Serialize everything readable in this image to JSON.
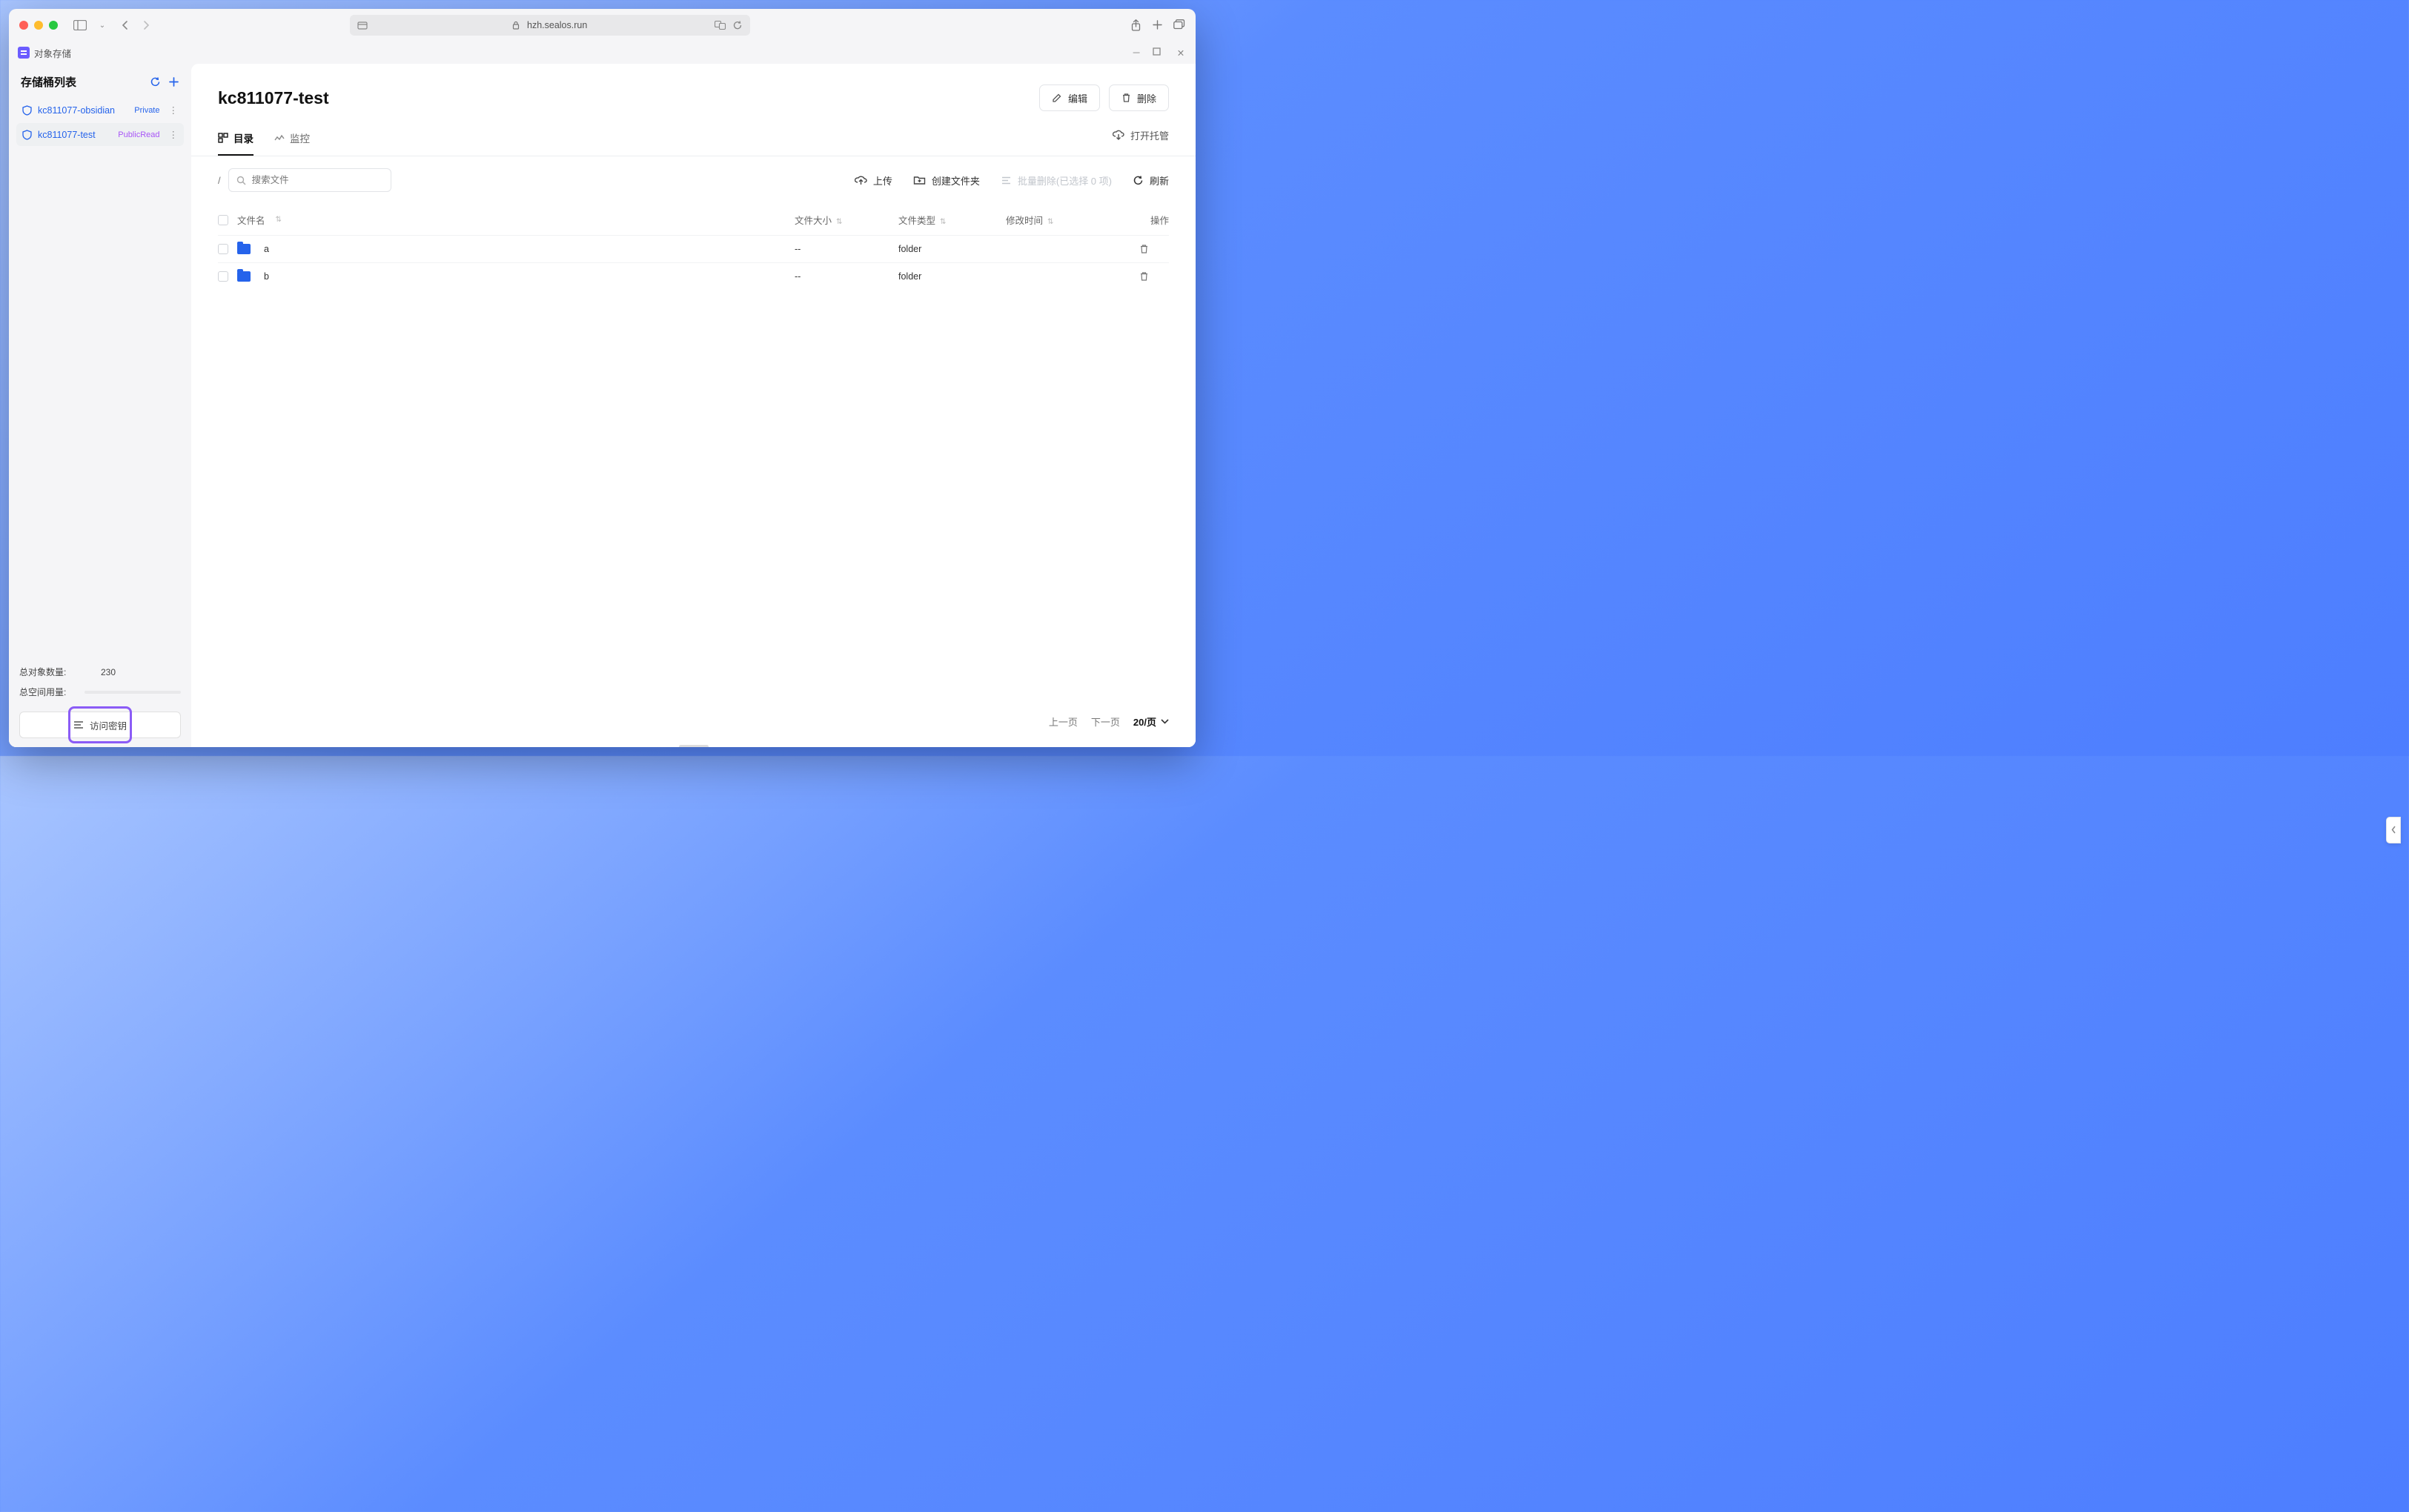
{
  "browser": {
    "url_host": "hzh.sealos.run"
  },
  "app_titlebar": {
    "title": "对象存储"
  },
  "sidebar": {
    "header": "存储桶列表",
    "buckets": [
      {
        "name": "kc811077-obsidian",
        "access": "Private",
        "active": false
      },
      {
        "name": "kc811077-test",
        "access": "PublicRead",
        "active": true
      }
    ],
    "stats": {
      "objects_label": "总对象数量:",
      "objects_value": "230",
      "space_label": "总空间用量:"
    },
    "access_key_label": "访问密钥"
  },
  "main": {
    "title": "kc811077-test",
    "edit_label": "编辑",
    "delete_label": "删除",
    "tabs": {
      "dir": "目录",
      "monitor": "监控"
    },
    "open_hosting_label": "打开托管",
    "breadcrumb": "/",
    "search_placeholder": "搜索文件",
    "actions": {
      "upload": "上传",
      "create_folder": "创建文件夹",
      "batch_delete": "批量删除(已选择 0 项)",
      "refresh": "刷新"
    },
    "table": {
      "headers": {
        "name": "文件名",
        "size": "文件大小",
        "type": "文件类型",
        "mtime": "修改时间",
        "op": "操作"
      },
      "rows": [
        {
          "name": "a",
          "size": "--",
          "type": "folder",
          "mtime": ""
        },
        {
          "name": "b",
          "size": "--",
          "type": "folder",
          "mtime": ""
        }
      ]
    },
    "pagination": {
      "prev": "上一页",
      "next": "下一页",
      "page_size": "20/页"
    }
  }
}
